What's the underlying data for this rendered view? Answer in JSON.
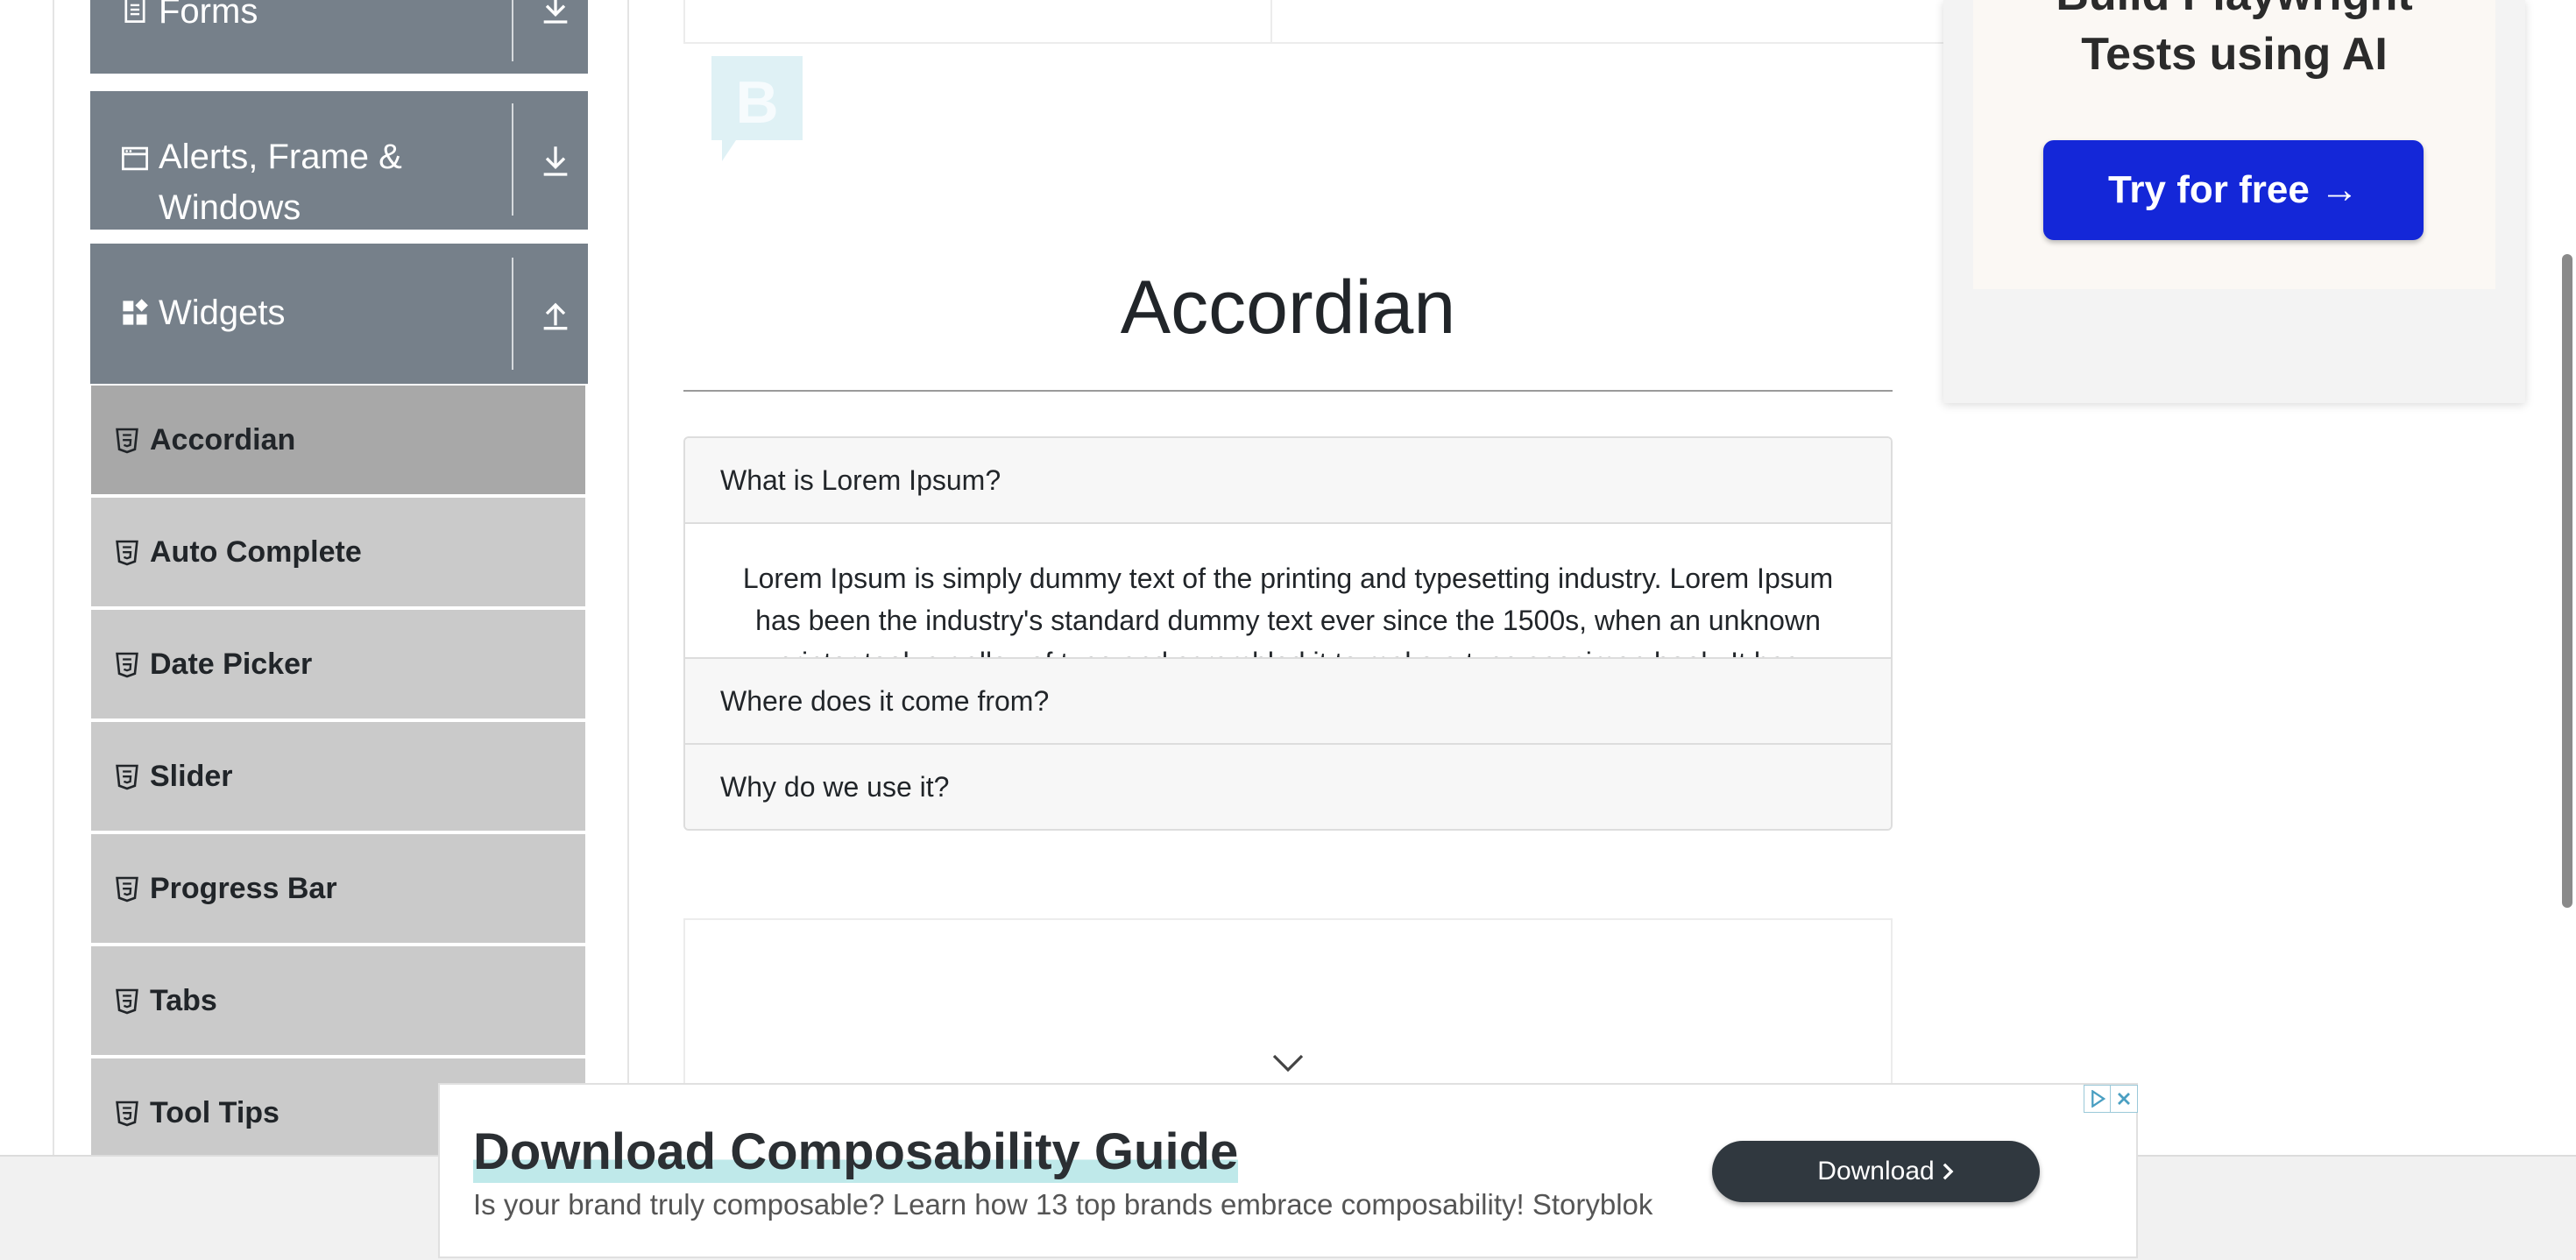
{
  "sidebar": {
    "groups": [
      {
        "label": "Forms"
      },
      {
        "label_line1": "Alerts, Frame &",
        "label_line2": "Windows"
      },
      {
        "label": "Widgets"
      }
    ],
    "items": [
      {
        "label": "Accordian"
      },
      {
        "label": "Auto Complete"
      },
      {
        "label": "Date Picker"
      },
      {
        "label": "Slider"
      },
      {
        "label": "Progress Bar"
      },
      {
        "label": "Tabs"
      },
      {
        "label": "Tool Tips"
      }
    ]
  },
  "main": {
    "title": "Accordian",
    "accordion": [
      {
        "header": "What is Lorem Ipsum?",
        "body": "Lorem Ipsum is simply dummy text of the printing and typesetting industry. Lorem Ipsum has been the industry's standard dummy text ever since the 1500s, when an unknown printer took a galley of type and scrambled it to make a type specimen book. It has"
      },
      {
        "header": "Where does it come from?"
      },
      {
        "header": "Why do we use it?"
      }
    ]
  },
  "right_ad": {
    "title_line1": "Build Playwright",
    "title_line2": "Tests using AI",
    "button_label": "Try for free →"
  },
  "bottom_ad": {
    "title": "Download Composability Guide",
    "description": "Is your brand truly composable? Learn how 13 top brands embrace composability! Storyblok",
    "button_label": "Download"
  },
  "colors": {
    "sidebar_header": "#76808a",
    "menu_item": "#cacaca",
    "menu_item_active": "#a8a8a8",
    "ad_button": "#1427d8",
    "download_button": "#30383f"
  }
}
